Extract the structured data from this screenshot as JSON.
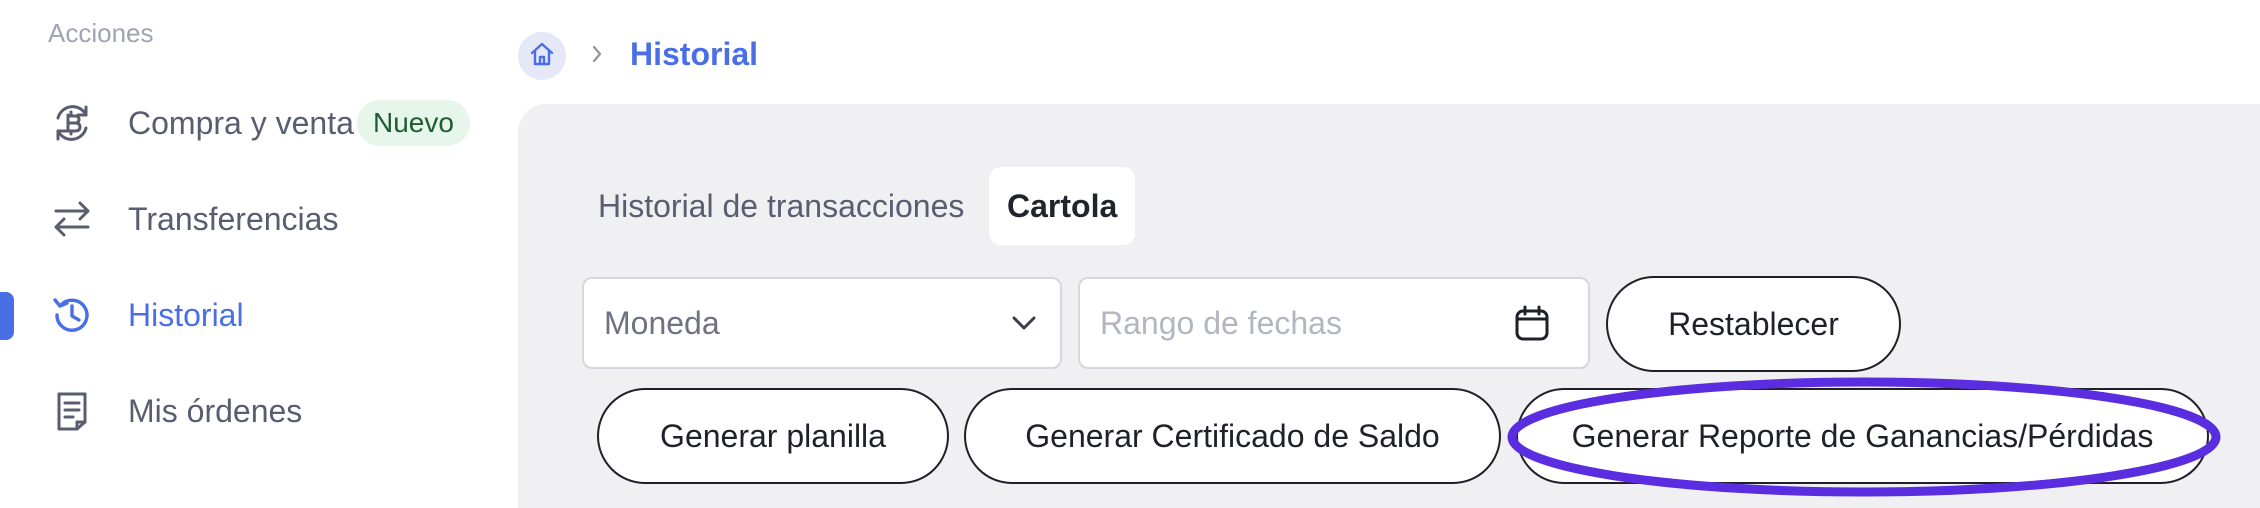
{
  "sidebar": {
    "section_title": "Acciones",
    "items": [
      {
        "label": "Compra y venta",
        "icon": "bitcoin-exchange-icon",
        "badge": "Nuevo"
      },
      {
        "label": "Transferencias",
        "icon": "transfer-arrows-icon"
      },
      {
        "label": "Historial",
        "icon": "history-icon",
        "active": true
      },
      {
        "label": "Mis órdenes",
        "icon": "document-icon"
      }
    ]
  },
  "breadcrumb": {
    "home_icon": "home-icon",
    "separator_icon": "chevron-right-icon",
    "current": "Historial"
  },
  "tabs": [
    {
      "label": "Historial de transacciones",
      "active": false
    },
    {
      "label": "Cartola",
      "active": true
    }
  ],
  "filters": {
    "currency": {
      "value": "Moneda",
      "icon": "chevron-down-icon"
    },
    "date_range": {
      "placeholder": "Rango de fechas",
      "icon": "calendar-icon"
    },
    "reset_label": "Restablecer"
  },
  "actions": {
    "planilla_label": "Generar planilla",
    "certificate_label": "Generar Certificado de Saldo",
    "report_label": "Generar Reporte de Ganancias/Pérdidas"
  },
  "colors": {
    "accent": "#4a6ee6",
    "badge_bg": "#e6f6ea",
    "badge_text": "#205c31",
    "panel_bg": "#f0f0f3",
    "highlight": "#5a2ee0"
  }
}
